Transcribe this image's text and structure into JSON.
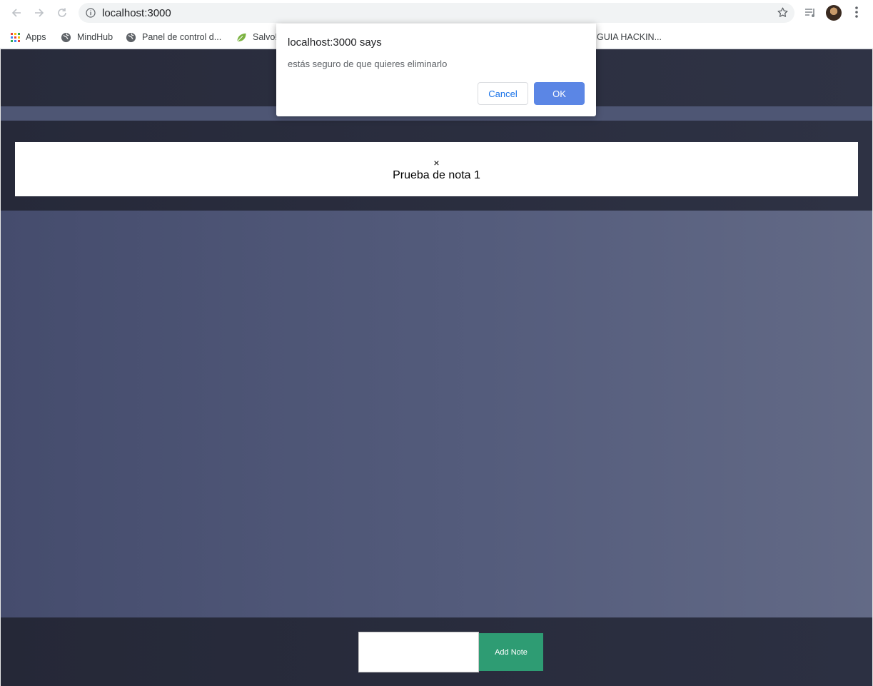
{
  "browser": {
    "url": "localhost:3000",
    "icons": {
      "back": "back-arrow-icon",
      "forward": "forward-arrow-icon",
      "reload": "reload-icon",
      "info": "info-icon",
      "star": "star-icon",
      "media": "media-queue-icon",
      "menu": "kebab-menu-icon"
    }
  },
  "bookmarks": [
    {
      "label": "Apps",
      "icon": "apps-grid-icon"
    },
    {
      "label": "MindHub",
      "icon": "globe-icon"
    },
    {
      "label": "Panel de control d...",
      "icon": "globe-icon"
    },
    {
      "label": "Salvo!",
      "icon": "leaf-icon"
    },
    {
      "label": "GUIA HACKIN...",
      "icon": ""
    }
  ],
  "app": {
    "notes": [
      {
        "delete_label": "×",
        "text": "Prueba de nota 1"
      }
    ],
    "input": {
      "value": "",
      "placeholder": ""
    },
    "add_button_label": "Add Note",
    "colors": {
      "header": "#2b2e3f",
      "stripe": "#4e5674",
      "main": "#545c7c",
      "footer": "#282b3b",
      "add_button": "#2e9c73"
    }
  },
  "dialog": {
    "title": "localhost:3000 says",
    "message": "estás seguro de que quieres eliminarlo",
    "cancel_label": "Cancel",
    "ok_label": "OK",
    "ok_color": "#5b86e5"
  }
}
